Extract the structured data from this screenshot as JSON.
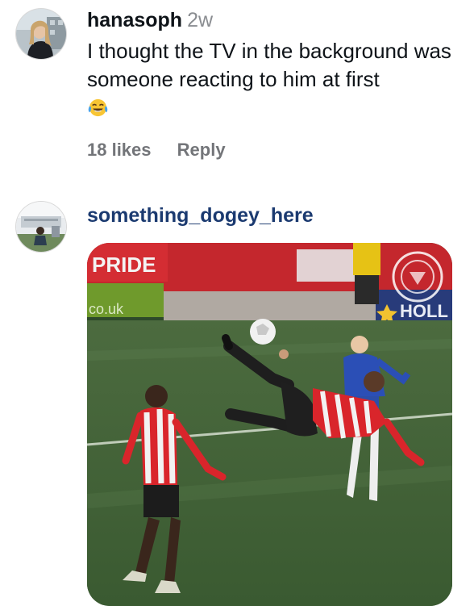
{
  "comments": [
    {
      "username": "hanasoph",
      "time": "2w",
      "text": "I thought the TV in the background was someone reacting to him at first",
      "emoji": "face-with-tears-of-joy",
      "likes": "18 likes",
      "reply_label": "Reply"
    },
    {
      "username": "something_dogey_here",
      "media": {
        "board_left": "PRIDE",
        "board_left_sub": "co.uk",
        "board_right": "HOLL"
      }
    }
  ],
  "colors": {
    "username_link": "#1b3a70",
    "meta_gray": "#737579",
    "time_gray": "#8a8d91"
  }
}
